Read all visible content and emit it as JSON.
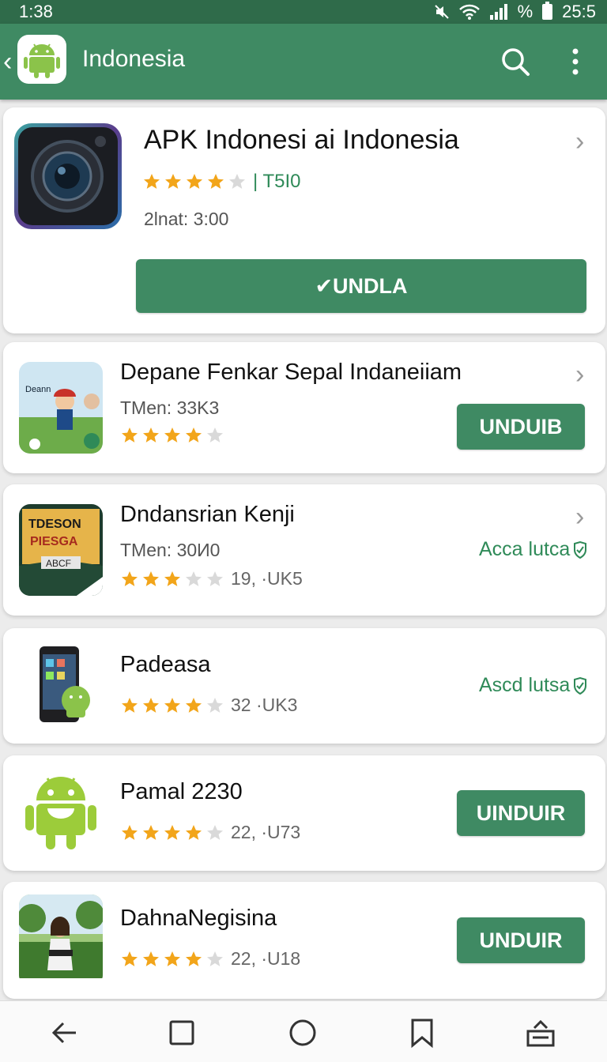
{
  "status_bar": {
    "time": "1:38",
    "battery_text": "% ",
    "clock_right": "25:5"
  },
  "app_bar": {
    "title": "Indonesia",
    "back_icon": "back-chevron-icon",
    "logo_icon": "android-logo-icon",
    "search_icon": "search-icon",
    "menu_icon": "more-vert-icon"
  },
  "featured": {
    "title": "APK Indonesi ai Indonesia",
    "rating_stars": 4,
    "rating_label": "| T5I0",
    "meta": "2lnat: 3:00",
    "button_label": "✔UNDLA",
    "icon": "camera-app-icon"
  },
  "apps": [
    {
      "title": "Depane Fenkar Sepal Indaneiiam",
      "meta": "TMen: 33K3",
      "rating_stars": 4,
      "rating_count": "",
      "action_type": "button",
      "action_label": "UNDUIB",
      "has_chevron": true,
      "icon": "game-poster-icon"
    },
    {
      "title": "Dndansrian Kenji",
      "meta": "TMen: 30И0",
      "rating_stars": 3,
      "rating_count": "19, ·UK5",
      "action_type": "link",
      "action_label": "Acca lutca",
      "has_chevron": true,
      "icon": "poster-app-icon"
    },
    {
      "title": "Padeasa",
      "meta": "",
      "rating_stars": 4,
      "rating_count": "32 ·UK3",
      "action_type": "link",
      "action_label": "Ascd lutsa",
      "has_chevron": false,
      "icon": "phone-android-icon"
    },
    {
      "title": "Pamal 2230",
      "meta": "",
      "rating_stars": 4,
      "rating_count": "22, ·U73",
      "action_type": "button",
      "action_label": "UINDUIR",
      "has_chevron": false,
      "icon": "android-mascot-icon"
    },
    {
      "title": "DahnaNegisina",
      "meta": "",
      "rating_stars": 4,
      "rating_count": "22, ·U18",
      "action_type": "button",
      "action_label": "UNDUIR",
      "has_chevron": false,
      "icon": "photo-app-icon"
    }
  ],
  "bottom_nav": [
    "back-arrow-icon",
    "square-icon",
    "circle-home-icon",
    "bookmark-icon",
    "download-tray-icon"
  ],
  "colors": {
    "primary": "#3f8a63",
    "status_bar": "#2f6b4a",
    "star": "#f2a51a",
    "star_empty": "#d9d9d9",
    "link_green": "#2f8a58"
  }
}
